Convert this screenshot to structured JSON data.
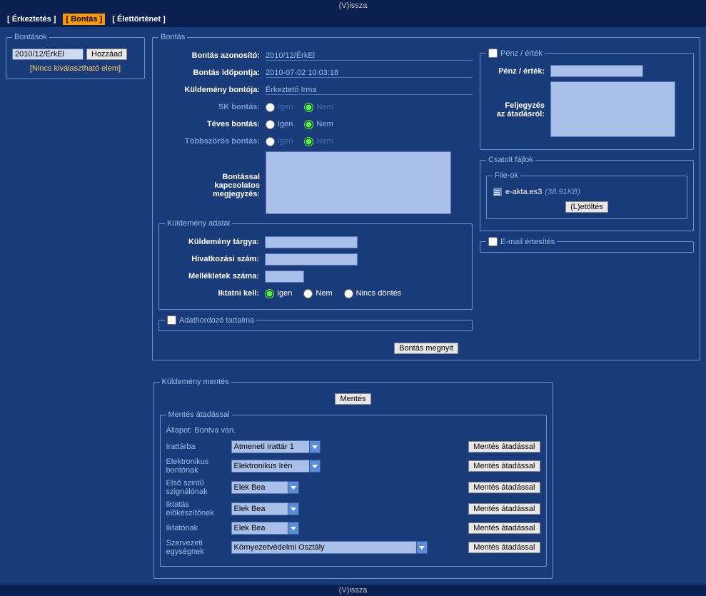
{
  "topbar": {
    "back": "(V)issza"
  },
  "tabs": {
    "t1": "[ Érkeztetés ]",
    "t2": "[  Bontás  ]",
    "t3": "[ Élettörténet ]"
  },
  "bontasok": {
    "legend": "Bontások",
    "id_value": "2010/12/ÉrkEl",
    "add_btn": "Hozzáad",
    "no_items": "[Nincs kiválasztható elem]"
  },
  "bontas": {
    "legend": "Bontás",
    "id_label": "Bontás azonosító:",
    "id_value": "2010/12/ÉrkEl",
    "time_label": "Bontás időpontja:",
    "time_value": "2010-07-02 10:03:18",
    "opener_label": "Küldemény bontója:",
    "opener_value": "Érkeztető Irma",
    "sk_label": "SK bontás:",
    "teves_label": "Téves bontás:",
    "multi_label": "Többszörös bontás:",
    "igen": "Igen",
    "nem": "Nem",
    "note_label1": "Bontással",
    "note_label2": "kapcsolatos",
    "note_label3": "megjegyzés:"
  },
  "kuldemeny": {
    "legend": "Küldemény adatai",
    "subject_label": "Küldemény tárgya:",
    "ref_label": "Hivatkozási szám:",
    "attach_label": "Mellékletek száma:",
    "iktat_label": "Iktatni kell:",
    "nincs": "Nincs döntés"
  },
  "adathordozo": {
    "label": "Adathordozó tartalma"
  },
  "penz": {
    "legend": "Pénz / érték",
    "label": "Pénz / érték:",
    "note_label1": "Feljegyzés",
    "note_label2": "az átadásról:"
  },
  "csatolt": {
    "legend": "Csatolt fájlok",
    "fileok": "File-ok",
    "filename": "e-akta.es3",
    "filesize": "(38.91KB)",
    "download": "(L)etöltés"
  },
  "email": {
    "label": "E-mail értesítés"
  },
  "open_btn": "Bontás megnyit",
  "mentes": {
    "legend": "Küldemény mentés",
    "save_btn": "Mentés",
    "atadas_legend": "Mentés átadással",
    "status": "Állapot: Bontva van.",
    "irattar_label": "Irattárba",
    "irattar_val": "Átmeneti Irattár 1",
    "ebonto_label": "Elektronikus bontónak",
    "ebonto_val": "Elektronikus Irén",
    "szignalo_label": "Első szintű szignálónak",
    "szignalo_val": "Elek Bea",
    "elokeszito_label": "Iktatás előkészítőnek",
    "elokeszito_val": "Elek Bea",
    "iktato_label": "Iktatónak",
    "iktato_val": "Elek Bea",
    "szerv_label": "Szervezeti egységnek",
    "szerv_val": "Környezetvédelmi Osztály",
    "atadas_btn": "Mentés átadással"
  }
}
